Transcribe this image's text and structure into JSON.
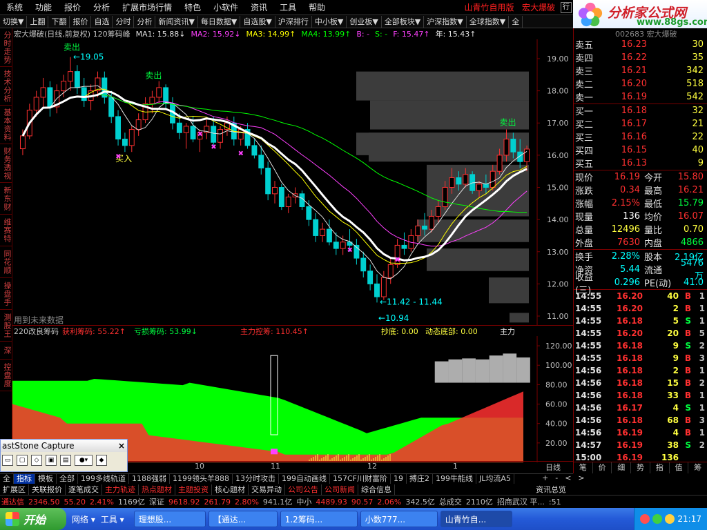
{
  "menu": {
    "items": [
      "系统",
      "功能",
      "报价",
      "分析",
      "扩展市场行情",
      "特色",
      "小软件",
      "资讯",
      "工具",
      "帮助"
    ],
    "app_title": "山青竹自用版",
    "stock_title": "宏大爆破",
    "win_button": "行"
  },
  "toolbar": {
    "items": [
      "切换▼",
      "上翻",
      "下翻",
      "报价",
      "自选",
      "分时",
      "分析",
      "新闻资讯▼",
      "每日数据▼",
      "自选股▼",
      "沪深排行",
      "中小板▼",
      "创业板▼",
      "全部板块▼",
      "沪深指数▼",
      "全球指数▼",
      "全"
    ]
  },
  "logo": {
    "main": "分析家公式网",
    "sub": "www.88gs.com"
  },
  "left_tabs": [
    "分时走势",
    "技术分析",
    "基本资料",
    "财务透视",
    "新东财",
    "维赛特",
    "同花顺",
    "操盘手",
    "测股王",
    "深",
    "控盘度"
  ],
  "chart_header": {
    "title": "宏大爆破(日线,前复权) 120筹码峰",
    "ma1": "MA1: 15.88↓",
    "ma2": "MA2: 15.92↓",
    "ma3": "MA3: 14.99↑",
    "ma4": "MA4: 13.99↑",
    "b": "B: -",
    "s": "S: -",
    "f": "F: 15.47↑",
    "year": "年: 15.43↑"
  },
  "colors": {
    "up": "#ff3030",
    "down": "#00d0d0",
    "ma1": "#e0e0e0",
    "ma2": "#ff40ff",
    "ma3": "#ffff00",
    "ma4": "#00ff00",
    "accent": "#ff2020"
  },
  "kline_annotations": {
    "sell1": "卖出",
    "sell2": "卖出",
    "sell3": "卖出",
    "buy1": "买入",
    "high": "19.05",
    "low_range": "11.42 - 11.44",
    "low": "10.94",
    "future_note": "用到未来数据"
  },
  "chart_data": {
    "type": "candlestick",
    "title": "宏大爆破(日线,前复权) 120筹码峰",
    "y_ticks": [
      "19.00",
      "18.00",
      "17.00",
      "16.00",
      "15.00",
      "14.00",
      "13.00",
      "12.00",
      "11.00"
    ],
    "ylim": [
      10.7,
      19.6
    ],
    "x_ticks": [
      "10",
      "11",
      "12",
      "1"
    ],
    "candles": [
      [
        16.2,
        16.8,
        16.0,
        16.6
      ],
      [
        16.6,
        17.6,
        16.5,
        17.4
      ],
      [
        17.4,
        18.0,
        17.2,
        17.8
      ],
      [
        17.8,
        18.4,
        17.5,
        18.1
      ],
      [
        18.1,
        18.3,
        17.2,
        17.5
      ],
      [
        17.5,
        18.2,
        17.3,
        18.0
      ],
      [
        18.0,
        18.5,
        17.8,
        18.3
      ],
      [
        18.3,
        19.05,
        18.0,
        18.6
      ],
      [
        18.6,
        18.8,
        17.9,
        18.1
      ],
      [
        18.1,
        18.4,
        17.5,
        17.7
      ],
      [
        17.7,
        18.2,
        17.4,
        18.0
      ],
      [
        18.0,
        18.6,
        17.8,
        18.4
      ],
      [
        18.4,
        18.6,
        17.6,
        17.8
      ],
      [
        17.8,
        18.0,
        17.0,
        17.2
      ],
      [
        17.2,
        17.4,
        16.3,
        16.5
      ],
      [
        16.5,
        16.7,
        16.1,
        16.3
      ],
      [
        16.3,
        16.9,
        16.1,
        16.8
      ],
      [
        16.8,
        17.3,
        16.6,
        17.1
      ],
      [
        17.1,
        17.8,
        17.0,
        17.6
      ],
      [
        17.6,
        18.0,
        17.3,
        17.8
      ],
      [
        17.8,
        18.3,
        17.6,
        18.1
      ],
      [
        18.1,
        18.2,
        17.4,
        17.6
      ],
      [
        17.6,
        17.8,
        16.8,
        17.0
      ],
      [
        17.0,
        17.3,
        16.5,
        16.7
      ],
      [
        16.7,
        17.0,
        16.2,
        16.9
      ],
      [
        16.9,
        17.2,
        16.4,
        16.5
      ],
      [
        16.5,
        16.8,
        16.1,
        16.7
      ],
      [
        16.7,
        17.1,
        16.5,
        16.9
      ],
      [
        16.9,
        17.2,
        16.3,
        16.4
      ],
      [
        16.4,
        16.9,
        16.2,
        16.8
      ],
      [
        16.8,
        17.2,
        16.6,
        17.0
      ],
      [
        17.0,
        17.2,
        16.3,
        16.5
      ],
      [
        16.5,
        16.9,
        16.3,
        16.8
      ],
      [
        16.8,
        17.0,
        16.2,
        16.3
      ],
      [
        16.3,
        16.5,
        15.9,
        16.0
      ],
      [
        16.0,
        16.3,
        15.4,
        15.6
      ],
      [
        15.6,
        15.8,
        14.6,
        14.8
      ],
      [
        14.8,
        15.2,
        14.5,
        15.0
      ],
      [
        15.0,
        15.1,
        14.3,
        14.4
      ],
      [
        14.4,
        14.8,
        14.2,
        14.7
      ],
      [
        14.7,
        15.0,
        14.5,
        14.8
      ],
      [
        14.8,
        14.9,
        14.3,
        14.4
      ],
      [
        14.4,
        14.6,
        13.8,
        14.0
      ],
      [
        14.0,
        14.2,
        13.3,
        13.5
      ],
      [
        13.5,
        13.9,
        13.3,
        13.7
      ],
      [
        13.7,
        14.0,
        13.2,
        13.3
      ],
      [
        13.3,
        13.6,
        12.9,
        13.1
      ],
      [
        13.1,
        13.5,
        12.9,
        13.3
      ],
      [
        13.3,
        13.7,
        13.0,
        13.2
      ],
      [
        13.2,
        13.4,
        12.6,
        12.8
      ],
      [
        12.8,
        13.0,
        12.2,
        12.4
      ],
      [
        12.4,
        12.6,
        11.8,
        12.0
      ],
      [
        12.0,
        12.3,
        11.42,
        11.6
      ],
      [
        11.6,
        12.4,
        11.5,
        12.2
      ],
      [
        12.2,
        12.8,
        12.0,
        12.6
      ],
      [
        12.6,
        13.4,
        12.5,
        13.2
      ],
      [
        13.2,
        13.6,
        12.9,
        13.1
      ],
      [
        13.1,
        13.7,
        13.0,
        13.5
      ],
      [
        13.5,
        14.0,
        13.3,
        13.8
      ],
      [
        13.8,
        14.2,
        13.5,
        13.7
      ],
      [
        13.7,
        14.3,
        13.6,
        14.1
      ],
      [
        14.1,
        14.6,
        13.9,
        14.4
      ],
      [
        14.4,
        15.2,
        14.3,
        15.0
      ],
      [
        15.0,
        15.6,
        14.8,
        15.3
      ],
      [
        15.3,
        15.5,
        14.9,
        15.1
      ],
      [
        15.1,
        15.6,
        15.0,
        15.4
      ],
      [
        15.4,
        15.5,
        14.8,
        14.9
      ],
      [
        14.9,
        15.2,
        14.7,
        15.1
      ],
      [
        15.1,
        15.4,
        14.8,
        15.0
      ],
      [
        15.0,
        15.7,
        14.9,
        15.5
      ],
      [
        15.5,
        16.2,
        15.4,
        16.0
      ],
      [
        16.0,
        16.8,
        15.8,
        16.5
      ],
      [
        16.5,
        16.7,
        15.9,
        16.1
      ],
      [
        16.1,
        16.5,
        15.6,
        15.8
      ],
      [
        15.8,
        16.3,
        15.5,
        16.19
      ]
    ],
    "chip_bars": [
      [
        15.8,
        16.7
      ],
      [
        14.1,
        15.7
      ],
      [
        12.4,
        13.1
      ],
      [
        11.4,
        12.2
      ],
      [
        10.8,
        11.1
      ],
      [
        17.7,
        18.6
      ],
      [
        16.8,
        17.7
      ],
      [
        16.0,
        16.7
      ],
      [
        13.3,
        14.0
      ]
    ],
    "indicator": {
      "title": "220改良筹码",
      "profit_label": "获利筹码: 55.22↑",
      "loss_label": "亏损筹码: 53.99↓",
      "main_label": "主力控筹: 110.45↑",
      "bottom_label": "抄底: 0.00",
      "dyn_label": "动态底部: 0.00",
      "zhuli": "主力",
      "y_ticks": [
        "120.00",
        "100.00",
        "80.00",
        "60.00",
        "40.00",
        "20.00"
      ],
      "ylim": [
        0,
        130
      ]
    },
    "axis_unit": "日线"
  },
  "quote": {
    "header": "002683 宏大爆破",
    "sell": [
      {
        "label": "卖五",
        "price": "16.23",
        "vol": "30"
      },
      {
        "label": "卖四",
        "price": "16.22",
        "vol": "35"
      },
      {
        "label": "卖三",
        "price": "16.21",
        "vol": "342"
      },
      {
        "label": "卖二",
        "price": "16.20",
        "vol": "518"
      },
      {
        "label": "卖一",
        "price": "16.19",
        "vol": "542"
      }
    ],
    "buy": [
      {
        "label": "买一",
        "price": "16.18",
        "vol": "32"
      },
      {
        "label": "买二",
        "price": "16.17",
        "vol": "21"
      },
      {
        "label": "买三",
        "price": "16.16",
        "vol": "22"
      },
      {
        "label": "买四",
        "price": "16.15",
        "vol": "40"
      },
      {
        "label": "买五",
        "price": "16.13",
        "vol": "9"
      }
    ],
    "stats": [
      {
        "k1": "现价",
        "v1": "16.19",
        "c1": "#ff3030",
        "k2": "今开",
        "v2": "15.80",
        "c2": "#ff3030"
      },
      {
        "k1": "涨跌",
        "v1": "0.34",
        "c1": "#ff3030",
        "k2": "最高",
        "v2": "16.21",
        "c2": "#ff3030"
      },
      {
        "k1": "涨幅",
        "v1": "2.15%",
        "c1": "#ff3030",
        "k2": "最低",
        "v2": "15.79",
        "c2": "#00ff40"
      },
      {
        "k1": "现量",
        "v1": "136",
        "c1": "#ffffff",
        "k2": "均价",
        "v2": "16.07",
        "c2": "#ff3030"
      },
      {
        "k1": "总量",
        "v1": "12496",
        "c1": "#ffff40",
        "k2": "量比",
        "v2": "0.70",
        "c2": "#ffff40"
      },
      {
        "k1": "外盘",
        "v1": "7630",
        "c1": "#ff3030",
        "k2": "内盘",
        "v2": "4866",
        "c2": "#00ff40"
      }
    ],
    "stats2": [
      {
        "k1": "换手",
        "v1": "2.28%",
        "c1": "#00ffff",
        "k2": "股本",
        "v2": "2.19亿",
        "c2": "#00ffff"
      },
      {
        "k1": "净资",
        "v1": "5.44",
        "c1": "#00ffff",
        "k2": "流通",
        "v2": "5476万",
        "c2": "#00ffff"
      },
      {
        "k1": "收益(三)",
        "v1": "0.296",
        "c1": "#00ffff",
        "k2": "PE(动)",
        "v2": "41.0",
        "c2": "#00ffff"
      }
    ],
    "ticks": [
      {
        "t": "14:55",
        "p": "16.20",
        "v": "40",
        "d": "B",
        "n": "1"
      },
      {
        "t": "14:55",
        "p": "16.20",
        "v": "2",
        "d": "B",
        "n": "1"
      },
      {
        "t": "14:55",
        "p": "16.18",
        "v": "5",
        "d": "S",
        "n": "1"
      },
      {
        "t": "14:55",
        "p": "16.20",
        "v": "20",
        "d": "B",
        "n": "5"
      },
      {
        "t": "14:55",
        "p": "16.18",
        "v": "9",
        "d": "S",
        "n": "2"
      },
      {
        "t": "14:55",
        "p": "16.18",
        "v": "9",
        "d": "B",
        "n": "3"
      },
      {
        "t": "14:56",
        "p": "16.18",
        "v": "2",
        "d": "B",
        "n": "1"
      },
      {
        "t": "14:56",
        "p": "16.18",
        "v": "15",
        "d": "B",
        "n": "2"
      },
      {
        "t": "14:56",
        "p": "16.18",
        "v": "33",
        "d": "B",
        "n": "1"
      },
      {
        "t": "14:56",
        "p": "16.17",
        "v": "4",
        "d": "S",
        "n": "1"
      },
      {
        "t": "14:56",
        "p": "16.18",
        "v": "68",
        "d": "B",
        "n": "3"
      },
      {
        "t": "14:56",
        "p": "16.19",
        "v": "4",
        "d": "B",
        "n": "1"
      },
      {
        "t": "14:57",
        "p": "16.19",
        "v": "38",
        "d": "S",
        "n": "2"
      },
      {
        "t": "15:00",
        "p": "16.19",
        "v": "136",
        "d": "",
        "n": ""
      }
    ],
    "tabs": [
      "笔",
      "价",
      "细",
      "势",
      "指",
      "值",
      "筹"
    ]
  },
  "bottom_tabs1": [
    "全",
    "指标",
    "模板",
    "全部",
    "199多线轨道",
    "1188强弱",
    "1199领头羊888",
    "13分时攻击",
    "199自动画线",
    "157CF川财富阶",
    "19",
    "搏庄2",
    "199牛能线",
    "JL均流A5"
  ],
  "bottom_tabs1_right": [
    "+",
    "-",
    "<",
    ">"
  ],
  "bottom_tabs2": [
    "扩展区",
    "关联报价",
    "逐笔成交",
    "主力轨迹",
    "热点题材",
    "主题投资",
    "核心题材",
    "交易异动",
    "公司公告",
    "公司新闻",
    "综合信息"
  ],
  "bottom_tabs2_right": "资讯总览",
  "index_bar": {
    "name1": "通达信",
    "val1": "2346.50",
    "chg1": "55.20",
    "pct1": "2.41%",
    "amt1": "1169亿",
    "name2": "深证",
    "val2": "9618.92",
    "chg2": "261.79",
    "pct2": "2.80%",
    "amt2": "941.1亿",
    "name3": "中小",
    "val3": "4489.93",
    "chg3": "90.57",
    "pct3": "2.06%",
    "amt3": "342.5亿",
    "total_label": "总成交",
    "total": "2110亿",
    "broker": "招商武汉 平...",
    "num": ":51"
  },
  "taskbar": {
    "start": "开始",
    "quick": [
      "网络 ▾",
      "工具 ▾"
    ],
    "items": [
      "理想股...",
      "【通达...",
      "1.2筹码...",
      "小数777...",
      "山青竹自..."
    ],
    "time": "21:17"
  },
  "capture": {
    "title": "astStone Capture",
    "close": "×"
  }
}
